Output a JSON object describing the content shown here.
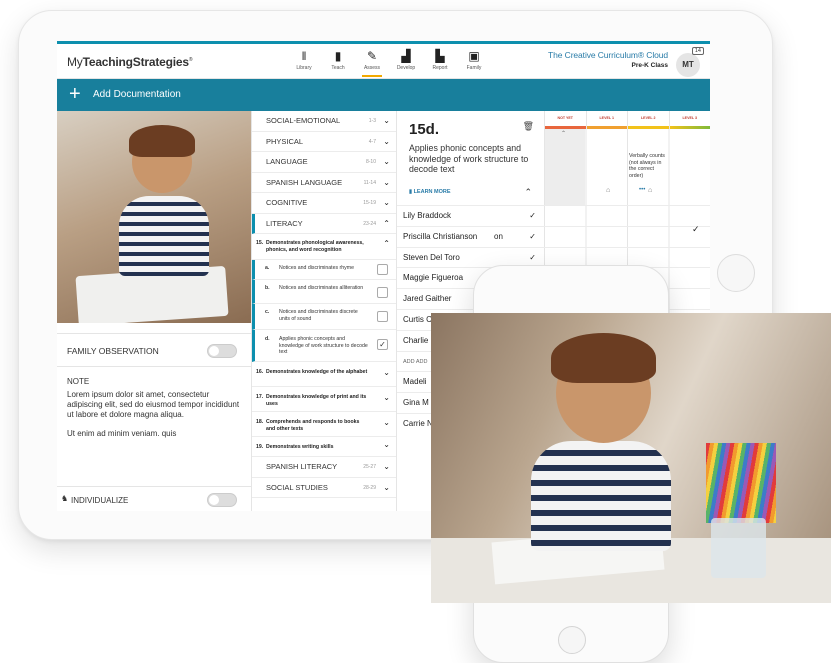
{
  "header": {
    "logo_prefix": "My",
    "logo_main": "TeachingStrategies",
    "logo_mark": "®",
    "nav": [
      {
        "label": "Library",
        "icon": "books-icon"
      },
      {
        "label": "Teach",
        "icon": "book-icon"
      },
      {
        "label": "Assess",
        "icon": "pencil-icon",
        "active": true
      },
      {
        "label": "Develop",
        "icon": "steps-icon"
      },
      {
        "label": "Report",
        "icon": "bar-chart-icon"
      },
      {
        "label": "Family",
        "icon": "family-icon"
      }
    ],
    "product": "The Creative Curriculum® Cloud",
    "class_name": "Pre-K Class",
    "avatar": "MT",
    "badge": "14"
  },
  "add_bar": {
    "label": "Add Documentation"
  },
  "left": {
    "family_observation": "FAMILY OBSERVATION",
    "note_heading": "NOTE",
    "note_p1": "Lorem ipsum dolor sit amet, consectetur adipiscing elit, sed do eiusmod tempor incididunt ut labore et dolore magna aliqua.",
    "note_p2": "Ut enim ad minim veniam. quis",
    "individualize": "INDIVIDUALIZE"
  },
  "domains": {
    "social_emotional": {
      "label": "SOCIAL-EMOTIONAL",
      "range": "1-3"
    },
    "physical": {
      "label": "PHYSICAL",
      "range": "4-7"
    },
    "language": {
      "label": "LANGUAGE",
      "range": "8-10"
    },
    "spanish_language": {
      "label": "SPANISH LANGUAGE",
      "range": "11-14"
    },
    "cognitive": {
      "label": "COGNITIVE",
      "range": "15-19"
    },
    "literacy": {
      "label": "LITERACY",
      "range": "23-24"
    },
    "obj15": {
      "num": "15.",
      "text": "Demonstrates phonological awareness, phonics, and word recognition"
    },
    "items": [
      {
        "num": "a.",
        "text": "Notices and discriminates rhyme",
        "checked": false
      },
      {
        "num": "b.",
        "text": "Notices and discriminates alliteration",
        "checked": false
      },
      {
        "num": "c.",
        "text": "Notices and discriminates discrete units of sound",
        "checked": false
      },
      {
        "num": "d.",
        "text": "Applies phonic concepts and knowledge of work structure to decode text",
        "checked": true
      }
    ],
    "objectives": [
      {
        "num": "16.",
        "text": "Demonstrates knowledge of the alphabet"
      },
      {
        "num": "17.",
        "text": "Demonstrates knowledge of print and its uses"
      },
      {
        "num": "18.",
        "text": "Comprehends and responds to books and other texts"
      },
      {
        "num": "19.",
        "text": "Demonstrates writing skills"
      }
    ],
    "spanish_literacy": {
      "label": "SPANISH LITERACY",
      "range": "25-27"
    },
    "social_studies": {
      "label": "SOCIAL STUDIES",
      "range": "28-29"
    }
  },
  "detail": {
    "code": "15d.",
    "description": "Applies phonic concepts and knowledge of work structure to decode text",
    "learn_more": "LEARN MORE",
    "students": [
      {
        "name": "Lily Braddock",
        "checked": true
      },
      {
        "name": "Priscilla Christianson",
        "extra": "on",
        "checked": true
      },
      {
        "name": "Steven Del Toro",
        "checked": true
      },
      {
        "name": "Maggie Figueroa"
      },
      {
        "name": "Jared Gaither"
      },
      {
        "name": "Curtis C"
      },
      {
        "name": "Charlie"
      },
      {
        "name": "ADD ADD",
        "small": true
      },
      {
        "name": "Madeli"
      },
      {
        "name": "Gina M"
      },
      {
        "name": "Carrie N"
      }
    ]
  },
  "levels": {
    "columns": [
      "NOT YET",
      "LEVEL 1",
      "LEVEL 2",
      "LEVEL 3"
    ],
    "example": "Verbally counts (not always in the correct order)",
    "dots": "•••"
  }
}
